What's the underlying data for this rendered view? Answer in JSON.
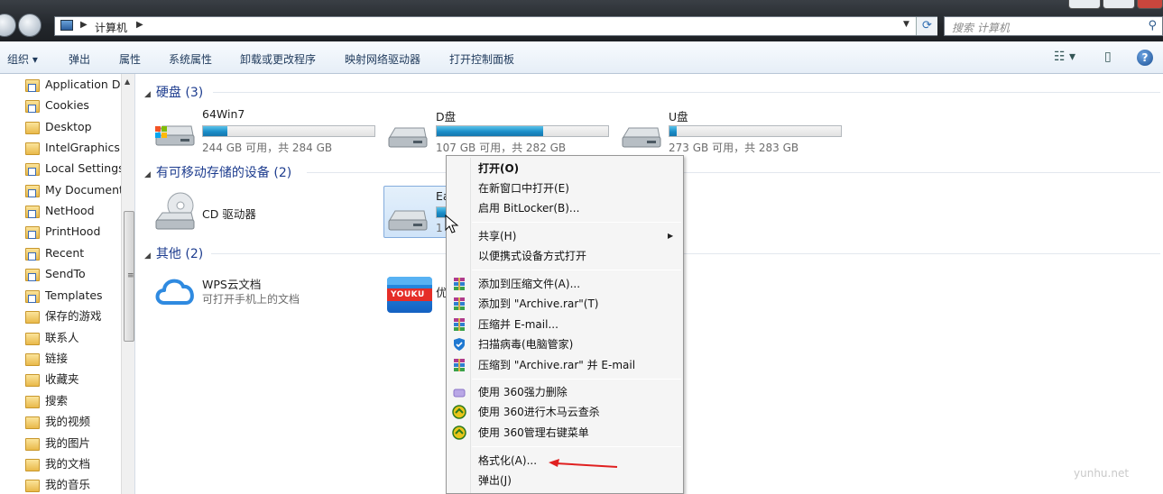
{
  "address": {
    "path_root": "计算机",
    "search_placeholder": "搜索 计算机"
  },
  "toolbar": {
    "organize": "组织 ▾",
    "items": [
      "弹出",
      "属性",
      "系统属性",
      "卸载或更改程序",
      "映射网络驱动器",
      "打开控制面板"
    ]
  },
  "sidebar": {
    "items": [
      "Application D",
      "Cookies",
      "Desktop",
      "IntelGraphicsP",
      "Local Settings",
      "My Documents",
      "NetHood",
      "PrintHood",
      "Recent",
      "SendTo",
      "Templates",
      "保存的游戏",
      "联系人",
      "链接",
      "收藏夹",
      "搜索",
      "我的视频",
      "我的图片",
      "我的文档",
      "我的音乐"
    ]
  },
  "groups": {
    "hdd": "硬盘 (3)",
    "removable": "有可移动存储的设备 (2)",
    "other": "其他 (2)"
  },
  "drives": [
    {
      "name": "64Win7",
      "info": "244 GB 可用，共 284 GB",
      "used_fraction": 0.14
    },
    {
      "name": "D盘",
      "info": "107 GB 可用，共 282 GB",
      "used_fraction": 0.62
    },
    {
      "name": "U盘",
      "info": "273 GB 可用，共 283 GB",
      "used_fraction": 0.04
    }
  ],
  "removable": {
    "cd": "CD 驱动器",
    "usb_name": "Ea",
    "usb_info": "1"
  },
  "others": {
    "wps_name": "WPS云文档",
    "wps_desc": "可打开手机上的文档",
    "youku_name": "优",
    "youku_logo": "YOUKU"
  },
  "context_menu": {
    "open": "打开(O)",
    "open_new_window": "在新窗口中打开(E)",
    "bitlocker": "启用 BitLocker(B)...",
    "share": "共享(H)",
    "portable": "以便携式设备方式打开",
    "add_archive": "添加到压缩文件(A)...",
    "add_archive_rar": "添加到 \"Archive.rar\"(T)",
    "compress_email": "压缩并 E-mail...",
    "scan_virus": "扫描病毒(电脑管家)",
    "compress_rar_email": "压缩到 \"Archive.rar\" 并 E-mail",
    "del_360": "使用 360强力删除",
    "scan_360": "使用 360进行木马云查杀",
    "manage_360": "使用 360管理右键菜单",
    "format": "格式化(A)...",
    "eject": "弹出(J)"
  },
  "watermark": "yunhu.net",
  "colors": {
    "accent": "#1e3d8f",
    "bar": "#1b8ec9",
    "arrow": "#e02020"
  }
}
